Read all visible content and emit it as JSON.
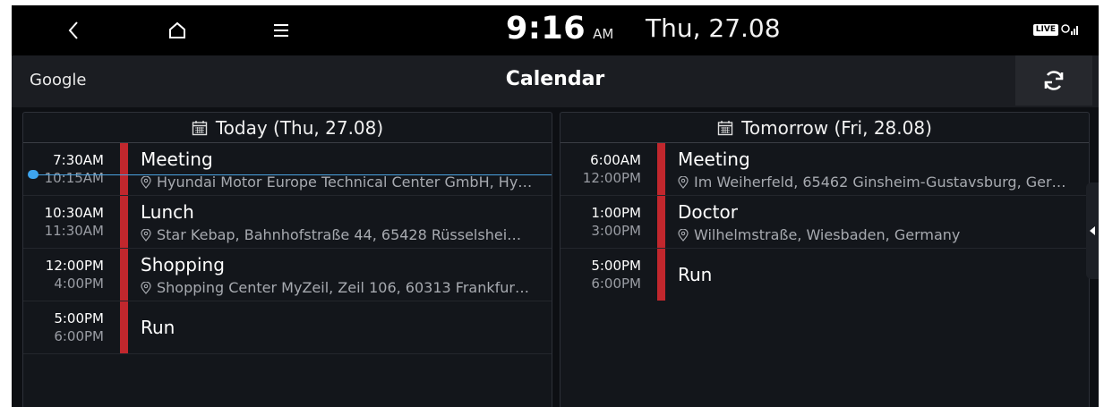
{
  "status_bar": {
    "time": "9:16",
    "ampm": "AM",
    "date": "Thu, 27.08",
    "live_badge": "LIVE"
  },
  "header": {
    "source": "Google",
    "title": "Calendar"
  },
  "today": {
    "header": "Today (Thu, 27.08)",
    "events": [
      {
        "start": "7:30AM",
        "end": "10:15AM",
        "title": "Meeting",
        "location": "Hyundai Motor Europe Technical Center GmbH, Hy…"
      },
      {
        "start": "10:30AM",
        "end": "11:30AM",
        "title": "Lunch",
        "location": "Star Kebap, Bahnhofstraße 44, 65428 Rüsselshei…"
      },
      {
        "start": "12:00PM",
        "end": "4:00PM",
        "title": "Shopping",
        "location": "Shopping Center MyZeil, Zeil 106, 60313 Frankfur…"
      },
      {
        "start": "5:00PM",
        "end": "6:00PM",
        "title": "Run",
        "location": ""
      }
    ]
  },
  "tomorrow": {
    "header": "Tomorrow (Fri, 28.08)",
    "events": [
      {
        "start": "6:00AM",
        "end": "12:00PM",
        "title": "Meeting",
        "location": "Im Weiherfeld, 65462 Ginsheim-Gustavsburg, Ger…"
      },
      {
        "start": "1:00PM",
        "end": "3:00PM",
        "title": "Doctor",
        "location": "Wilhelmstraße, Wiesbaden, Germany"
      },
      {
        "start": "5:00PM",
        "end": "6:00PM",
        "title": "Run",
        "location": ""
      }
    ]
  },
  "colors": {
    "event_bar": "#c1272d",
    "now_indicator": "#3ea4ee"
  }
}
